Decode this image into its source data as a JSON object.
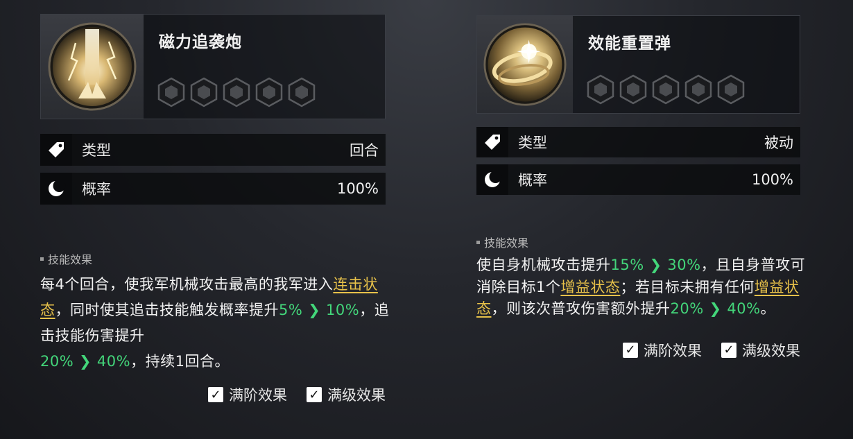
{
  "skills": [
    {
      "name": "磁力追袭炮",
      "icon": "lightning-beam-icon",
      "stars_total": 5,
      "stats": [
        {
          "icon": "tag-icon",
          "label": "类型",
          "value": "回合"
        },
        {
          "icon": "moon-icon",
          "label": "概率",
          "value": "100%"
        }
      ],
      "effect_title": "技能效果",
      "effect": {
        "p1": "每4个回合，使我军机械攻击最高的我军进入",
        "link1": "连击状态",
        "p2": "，同时使其追击技能触发概率提升",
        "v1": "5%",
        "v2": "10%",
        "p3": "，追击技能伤害提升",
        "v3": "20%",
        "v4": "40%",
        "p4": "，持续1回合。"
      },
      "options": [
        "满阶效果",
        "满级效果"
      ]
    },
    {
      "name": "效能重置弹",
      "icon": "energy-orb-icon",
      "stars_total": 5,
      "stats": [
        {
          "icon": "tag-icon",
          "label": "类型",
          "value": "被动"
        },
        {
          "icon": "moon-icon",
          "label": "概率",
          "value": "100%"
        }
      ],
      "effect_title": "技能效果",
      "effect": {
        "p1": "使自身机械攻击提升",
        "v1": "15%",
        "v2": "30%",
        "p2": "，且自身普攻可消除目标1个",
        "link1": "增益状态",
        "p3": "；若目标未拥有任何",
        "link2": "增益状态",
        "p4": "，则该次普攻伤害额外提升",
        "v3": "20%",
        "v4": "40%",
        "p5": "。"
      },
      "options": [
        "满阶效果",
        "满级效果"
      ]
    }
  ],
  "colors": {
    "highlight_green": "#43d67a",
    "keyword_gold": "#e8c24a",
    "star_empty": "#5a5c60"
  }
}
